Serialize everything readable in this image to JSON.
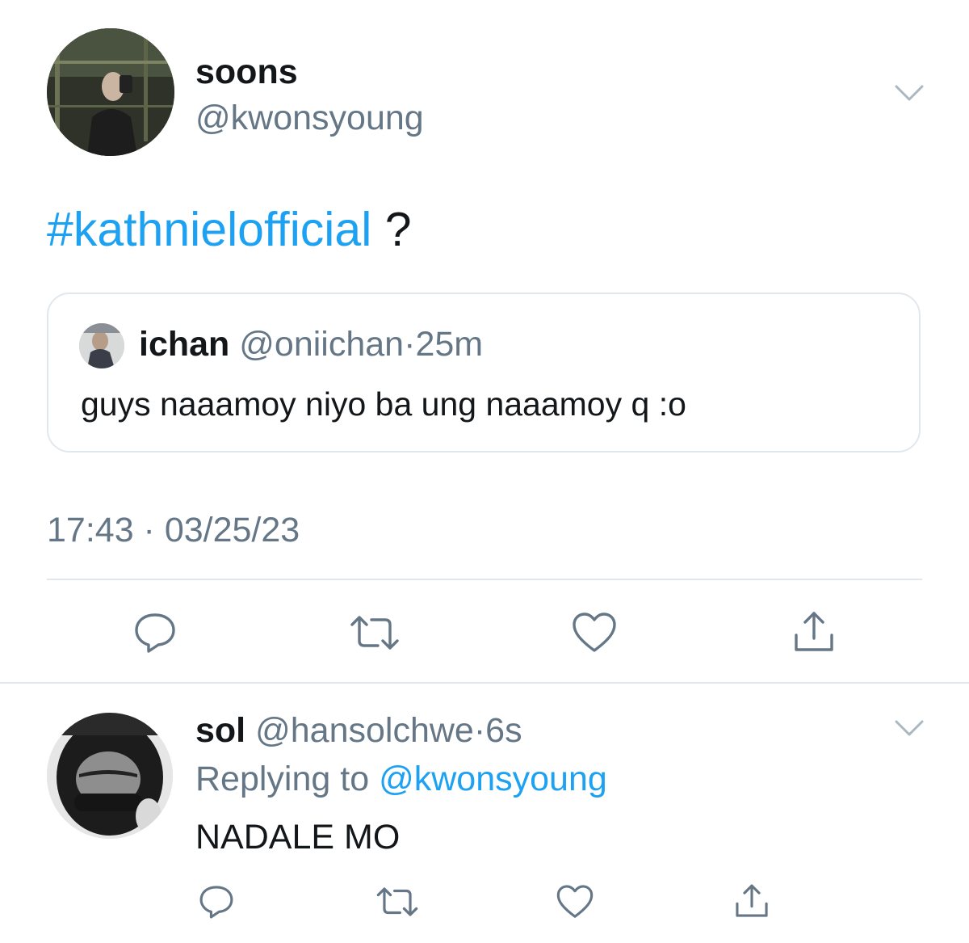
{
  "tweet": {
    "display_name": "soons",
    "handle": "@kwonsyoung",
    "hashtag": "#kathnielofficial",
    "text_suffix": " ?",
    "timestamp": "17:43 · 03/25/23",
    "avatar_icon": "profile-photo",
    "more_icon": "chevron-down-icon"
  },
  "quoted_tweet": {
    "display_name": "ichan",
    "handle": "@oniichan",
    "separator": "·",
    "time": "25m",
    "body": "guys naaamoy niyo ba ung naaamoy q :o"
  },
  "actions": {
    "reply_icon": "reply-icon",
    "retweet_icon": "retweet-icon",
    "like_icon": "heart-icon",
    "share_icon": "share-icon"
  },
  "reply": {
    "display_name": "sol",
    "handle": "@hansolchwe",
    "separator": "·",
    "time": "6s",
    "replying_prefix": "Replying to ",
    "replying_to": "@kwonsyoung",
    "body": "NADALE MO"
  },
  "colors": {
    "accent": "#1da1f2",
    "secondary_text": "#657786",
    "primary_text": "#14171a",
    "border": "#e1e8ed",
    "icon": "#657786"
  }
}
